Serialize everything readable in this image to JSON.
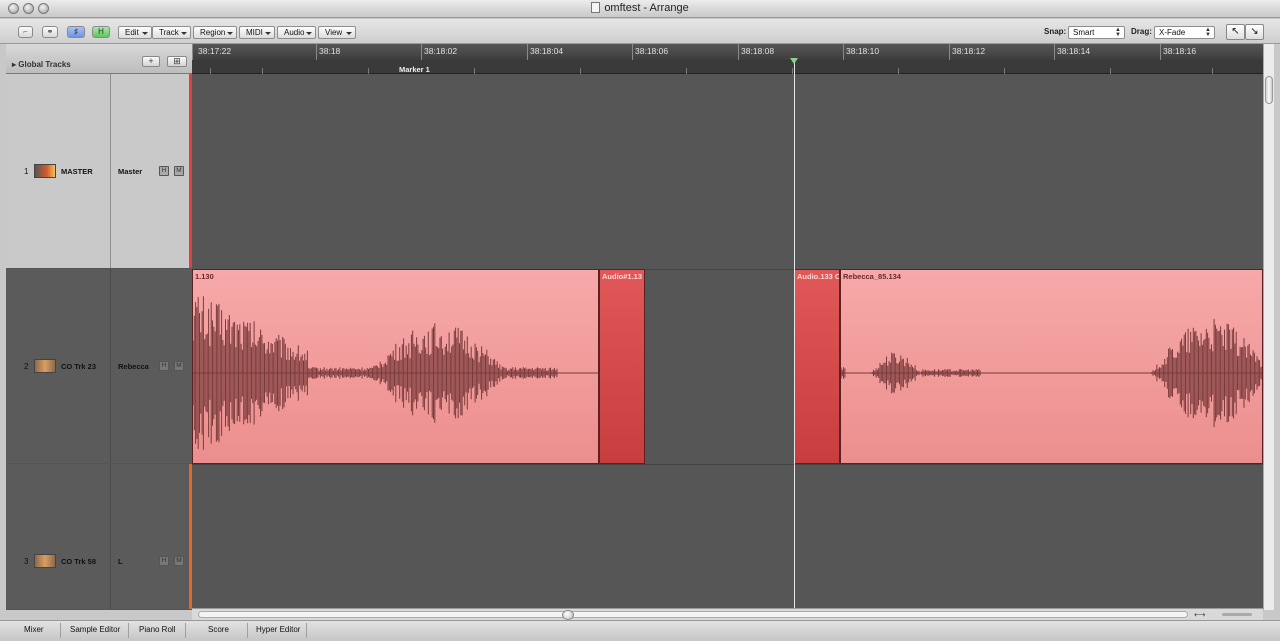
{
  "window": {
    "title": "omftest - Arrange"
  },
  "toolbar": {
    "menus": [
      "Edit",
      "Track",
      "Region",
      "MIDI",
      "Audio",
      "View"
    ],
    "snap_label": "Snap:",
    "snap_value": "Smart",
    "drag_label": "Drag:",
    "drag_value": "X-Fade"
  },
  "global_tracks": {
    "label": "Global Tracks"
  },
  "ruler": {
    "ticks": [
      "38:17:22",
      "38:18",
      "38:18:02",
      "38:18:04",
      "38:18:06",
      "38:18:08",
      "38:18:10",
      "38:18:12",
      "38:18:14",
      "38:18:16"
    ],
    "marker": "Marker 1"
  },
  "tracks": [
    {
      "number": "1",
      "name": "MASTER",
      "instrument": "Master",
      "h": "H",
      "m": "M",
      "icon": "master-fader-icon"
    },
    {
      "number": "2",
      "name": "CO Trk 23",
      "instrument": "Rebecca",
      "h": "H",
      "m": "M",
      "icon": "audio-waveform-icon"
    },
    {
      "number": "3",
      "name": "CO Trk 58",
      "instrument": "L",
      "h": "H",
      "m": "M",
      "icon": "audio-waveform-icon"
    }
  ],
  "regions": {
    "r1": "1.130",
    "r2": "Audio#1.13",
    "r3": "Audio.133 C",
    "r4": "Rebecca_85.134"
  },
  "bottom_tabs": [
    "Mixer",
    "Sample Editor",
    "Piano Roll",
    "Score",
    "Hyper Editor"
  ],
  "colors": {
    "region": "#f4a3a3",
    "region_selected": "#d94c4c",
    "arrange_bg": "#565656"
  }
}
